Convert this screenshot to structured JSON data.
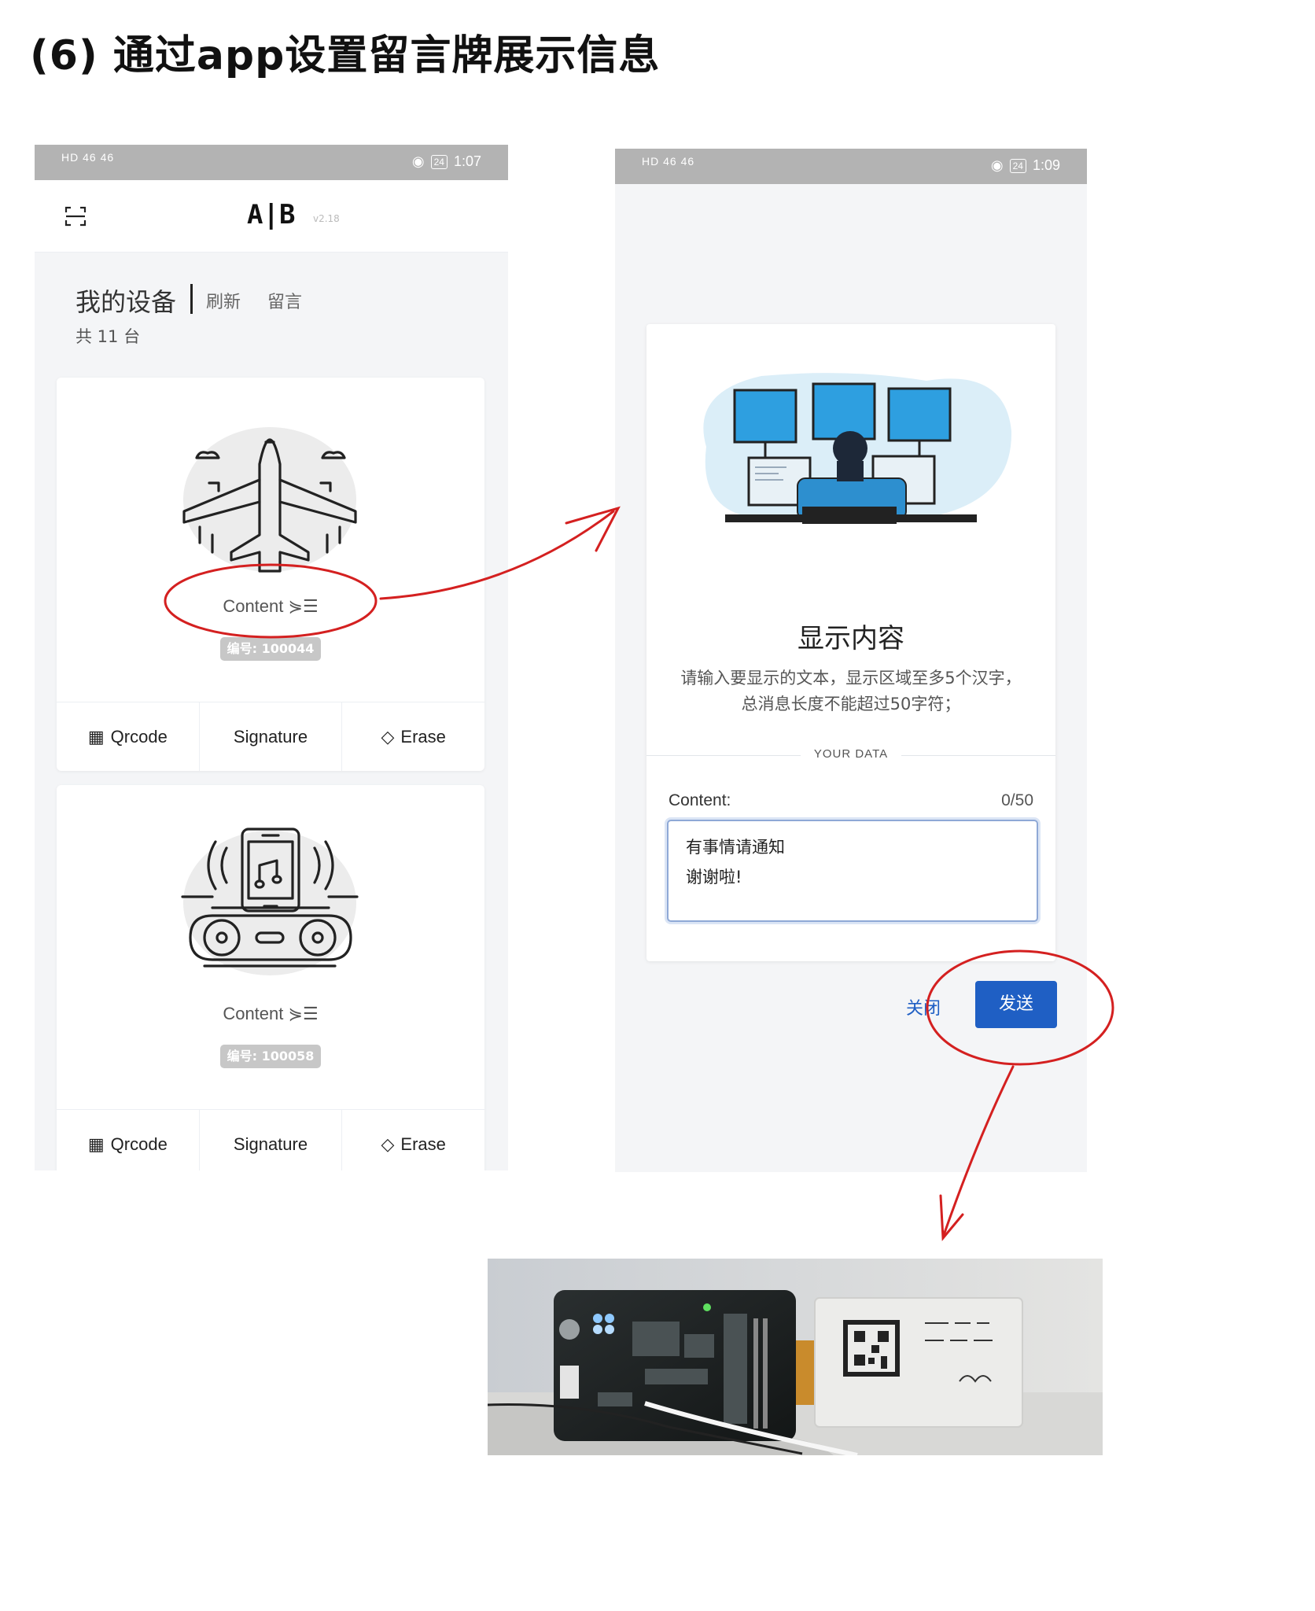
{
  "page": {
    "title": "(6) 通过app设置留言牌展示信息"
  },
  "phone1": {
    "statusbar": {
      "left": "HD 46 46 ",
      "time": "1:07",
      "battery": "24"
    },
    "appbar": {
      "logo": "A|B",
      "version": "v2.18"
    },
    "devices": {
      "title": "我的设备",
      "refresh_label": "刷新",
      "message_label": "留言",
      "count_label": "共 11 台"
    },
    "cards": [
      {
        "content_label": "Content",
        "tag": "编号: 100044",
        "illustration": "airplane-icon",
        "actions": {
          "qrcode": "Qrcode",
          "signature": "Signature",
          "erase": "Erase"
        }
      },
      {
        "content_label": "Content",
        "tag": "编号: 100058",
        "illustration": "music-phone-icon",
        "actions": {
          "qrcode": "Qrcode",
          "signature": "Signature",
          "erase": "Erase"
        }
      }
    ]
  },
  "phone2": {
    "statusbar": {
      "left": "HD 46 46 ",
      "time": "1:09",
      "battery": "24"
    },
    "dialog": {
      "title": "显示内容",
      "description": "请输入要显示的文本，显示区域至多5个汉字，总消息长度不能超过50字符；",
      "section_label": "YOUR DATA",
      "field_label": "Content:",
      "counter": "0/50",
      "text_value": "有事情请通知\n谢谢啦!",
      "close_label": "关闭",
      "send_label": "发送"
    }
  },
  "colors": {
    "accent": "#1f5fc4",
    "annotation": "#d42020",
    "statusbar": "#b3b3b3"
  }
}
